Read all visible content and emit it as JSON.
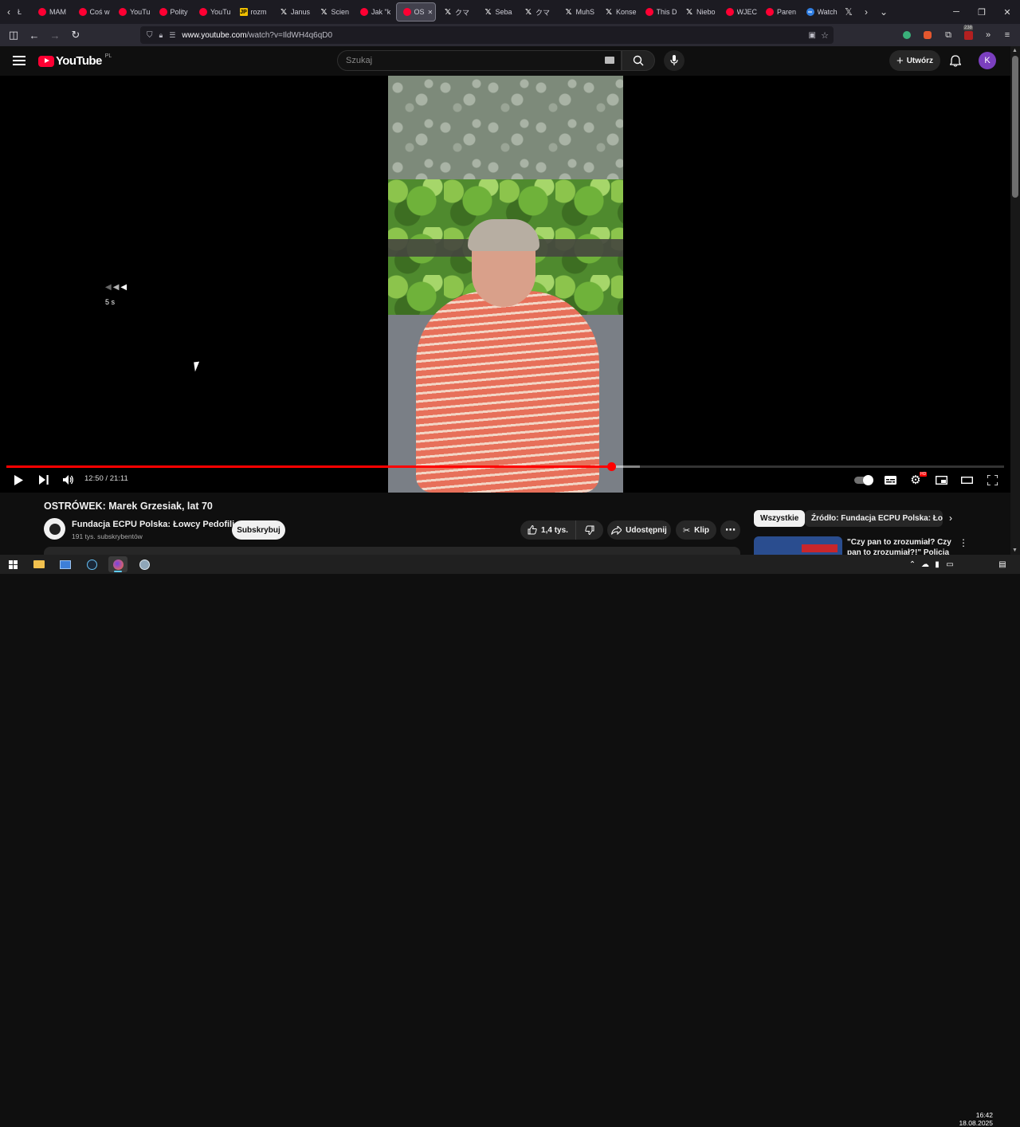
{
  "browser": {
    "tabs": [
      {
        "label": "MAM",
        "favicon": "yt"
      },
      {
        "label": "Coś w",
        "favicon": "yt"
      },
      {
        "label": "YouTu",
        "favicon": "yt"
      },
      {
        "label": "Polity",
        "favicon": "yt"
      },
      {
        "label": "YouTu",
        "favicon": "yt"
      },
      {
        "label": "rozm",
        "favicon": "jp"
      },
      {
        "label": "Janus",
        "favicon": "x"
      },
      {
        "label": "Scien",
        "favicon": "x"
      },
      {
        "label": "Jak \"k",
        "favicon": "yt"
      },
      {
        "label": "OS",
        "favicon": "yt",
        "active": true
      },
      {
        "label": "クマ",
        "favicon": "x"
      },
      {
        "label": "Seba",
        "favicon": "x"
      },
      {
        "label": "クマ",
        "favicon": "x"
      },
      {
        "label": "MuhS",
        "favicon": "x"
      },
      {
        "label": "Konse",
        "favicon": "x"
      },
      {
        "label": "This D",
        "favicon": "yt"
      },
      {
        "label": "Niebo",
        "favicon": "x"
      },
      {
        "label": "WJEC",
        "favicon": "yt"
      },
      {
        "label": "Paren",
        "favicon": "yt"
      },
      {
        "label": "Watch",
        "favicon": "sixty"
      }
    ],
    "url_host": "www.youtube.com",
    "url_path": "/watch?v=IldWH4q6qD0",
    "notif_count": "238"
  },
  "youtube": {
    "logo_text": "YouTube",
    "country": "PL",
    "search_placeholder": "Szukaj",
    "create_label": "Utwórz",
    "avatar_letter": "K"
  },
  "player": {
    "skip_label": "5 s",
    "current_time": "12:50",
    "duration": "21:11",
    "time_display": "12:50 / 21:11",
    "progress_fraction": 0.606,
    "buffered_fraction": 0.635,
    "hd_badge": "HD"
  },
  "video": {
    "title": "OSTRÓWEK: Marek Grzesiak, lat 70",
    "channel": "Fundacja ECPU Polska: Łowcy Pedofili",
    "subscribers": "191 tys. subskrybentów",
    "subscribe_label": "Subskrybuj",
    "likes": "1,4 tys.",
    "share_label": "Udostępnij",
    "clip_label": "Klip"
  },
  "sidebar": {
    "chips": [
      "Wszystkie",
      "Źródło: Fundacja ECPU Polska: Łowcy"
    ],
    "rec_title": "\"Czy pan to zrozumiał? Czy pan to zrozumiał?!\" Policja z ekrop"
  },
  "taskbar": {
    "time": "16:42",
    "date": "18.08.2025"
  },
  "colors": {
    "yt_red": "#ff0033",
    "progress_red": "#ff0000",
    "avatar": "#7b3fbf",
    "active_indicator": "#60cdff"
  }
}
